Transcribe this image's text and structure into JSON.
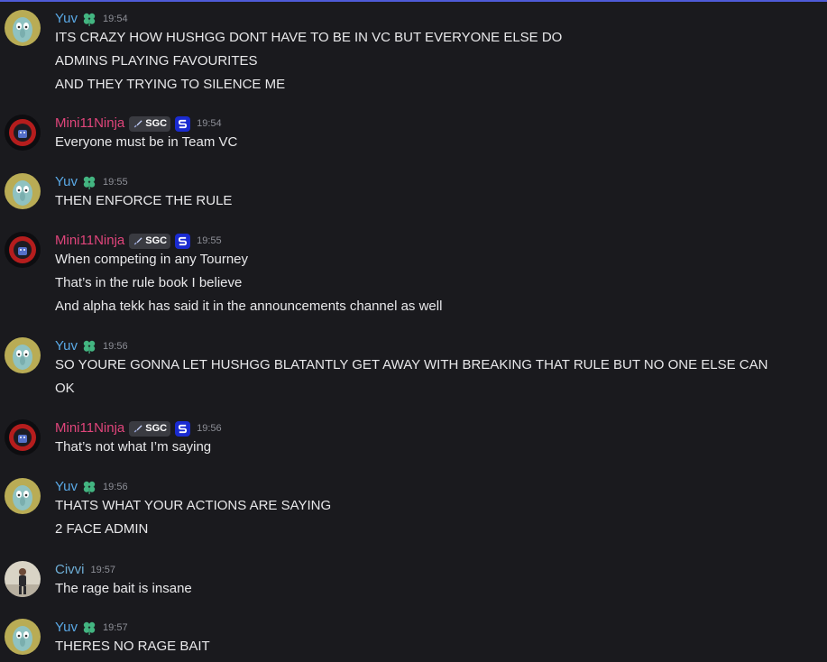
{
  "messages": [
    {
      "author": "Yuv",
      "role": "yuv",
      "time": "19:54",
      "lines": [
        "ITS CRAZY HOW HUSHGG DONT HAVE TO BE IN VC BUT EVERYONE ELSE DO",
        "ADMINS PLAYING FAVOURITES",
        "AND THEY TRYING TO SILENCE ME"
      ]
    },
    {
      "author": "Mini11Ninja",
      "role": "mini",
      "tag": "SGC",
      "time": "19:54",
      "lines": [
        "Everyone must be in Team VC"
      ]
    },
    {
      "author": "Yuv",
      "role": "yuv",
      "time": "19:55",
      "lines": [
        "THEN ENFORCE THE RULE"
      ]
    },
    {
      "author": "Mini11Ninja",
      "role": "mini",
      "tag": "SGC",
      "time": "19:55",
      "lines": [
        "When competing in any Tourney",
        "That’s in the rule book I believe",
        "And alpha tekk has said it in the announcements channel as well"
      ]
    },
    {
      "author": "Yuv",
      "role": "yuv",
      "time": "19:56",
      "lines": [
        "SO YOURE GONNA LET HUSHGG BLATANTLY GET AWAY WITH BREAKING THAT RULE BUT NO ONE ELSE CAN",
        "OK"
      ]
    },
    {
      "author": "Mini11Ninja",
      "role": "mini",
      "tag": "SGC",
      "time": "19:56",
      "lines": [
        "That’s not what I’m saying"
      ]
    },
    {
      "author": "Yuv",
      "role": "yuv",
      "time": "19:56",
      "lines": [
        "THATS WHAT YOUR ACTIONS ARE SAYING",
        "2 FACE ADMIN"
      ]
    },
    {
      "author": "Civvi",
      "role": "civvi",
      "time": "19:57",
      "lines": [
        "The rage bait is insane"
      ]
    },
    {
      "author": "Yuv",
      "role": "yuv",
      "time": "19:57",
      "lines": [
        "THERES NO RAGE BAIT"
      ]
    }
  ],
  "icons": {
    "yuv_badge": "clover-icon",
    "mini_tag_icon": "sword-icon",
    "mini_badge": "s-logo-icon"
  },
  "colors": {
    "background": "#1a1a1e",
    "yuv_name": "#5aa9e6",
    "mini_name": "#e0457b",
    "civvi_name": "#6eaed6",
    "text": "#e8e8ea",
    "timestamp": "#8d8f97"
  }
}
